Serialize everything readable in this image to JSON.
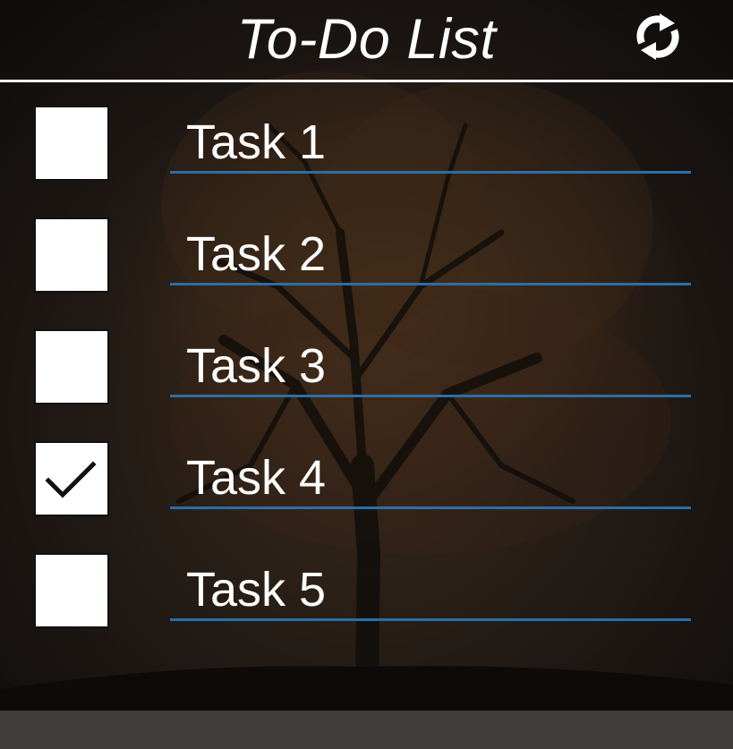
{
  "app": {
    "title": "To-Do List",
    "refresh_icon": "refresh-icon"
  },
  "tasks": [
    {
      "label": "Task 1",
      "checked": false
    },
    {
      "label": "Task 2",
      "checked": false
    },
    {
      "label": "Task 3",
      "checked": false
    },
    {
      "label": "Task 4",
      "checked": true
    },
    {
      "label": "Task 5",
      "checked": false
    }
  ],
  "colors": {
    "background": "#151210",
    "text": "#ffffff",
    "underline": "#2a6fa8",
    "checkbox": "#ffffff",
    "checkmark": "#111111"
  }
}
